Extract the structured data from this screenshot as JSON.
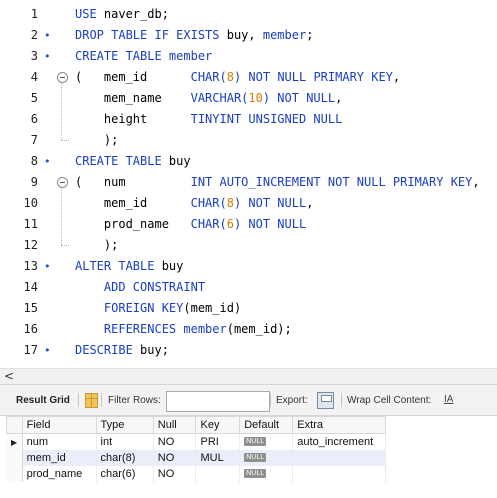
{
  "editor": {
    "lines": [
      {
        "n": "1",
        "marker": "",
        "fold": false,
        "tokens": [
          {
            "t": "USE ",
            "c": "kw"
          },
          {
            "t": "naver_db;",
            "c": "id"
          }
        ]
      },
      {
        "n": "2",
        "marker": "•",
        "fold": false,
        "tokens": [
          {
            "t": "DROP TABLE IF EXISTS ",
            "c": "kw"
          },
          {
            "t": "buy, ",
            "c": "id"
          },
          {
            "t": "member",
            "c": "kw"
          },
          {
            "t": ";",
            "c": "id"
          }
        ]
      },
      {
        "n": "3",
        "marker": "•",
        "fold": false,
        "tokens": [
          {
            "t": "CREATE TABLE ",
            "c": "kw"
          },
          {
            "t": "member",
            "c": "kw"
          }
        ]
      },
      {
        "n": "4",
        "marker": "",
        "fold": true,
        "tokens": [
          {
            "t": "(   ",
            "c": "id"
          },
          {
            "t": "mem_id      ",
            "c": "id"
          },
          {
            "t": "CHAR(",
            "c": "kw"
          },
          {
            "t": "8",
            "c": "num"
          },
          {
            "t": ") NOT NULL PRIMARY KEY",
            "c": "kw"
          },
          {
            "t": ",",
            "c": "id"
          }
        ]
      },
      {
        "n": "5",
        "marker": "",
        "fold": false,
        "tokens": [
          {
            "t": "    mem_name    ",
            "c": "id"
          },
          {
            "t": "VARCHAR(",
            "c": "kw"
          },
          {
            "t": "10",
            "c": "num"
          },
          {
            "t": ") NOT NULL",
            "c": "kw"
          },
          {
            "t": ",",
            "c": "id"
          }
        ]
      },
      {
        "n": "6",
        "marker": "",
        "fold": false,
        "tokens": [
          {
            "t": "    height      ",
            "c": "id"
          },
          {
            "t": "TINYINT UNSIGNED NULL",
            "c": "kw"
          }
        ]
      },
      {
        "n": "7",
        "marker": "",
        "fold": false,
        "tokens": [
          {
            "t": "    );",
            "c": "id"
          }
        ]
      },
      {
        "n": "8",
        "marker": "•",
        "fold": false,
        "tokens": [
          {
            "t": "CREATE TABLE ",
            "c": "kw"
          },
          {
            "t": "buy",
            "c": "id"
          }
        ]
      },
      {
        "n": "9",
        "marker": "",
        "fold": true,
        "tokens": [
          {
            "t": "(   ",
            "c": "id"
          },
          {
            "t": "num         ",
            "c": "id"
          },
          {
            "t": "INT AUTO_INCREMENT NOT NULL PRIMARY KEY",
            "c": "kw"
          },
          {
            "t": ",",
            "c": "id"
          }
        ]
      },
      {
        "n": "10",
        "marker": "",
        "fold": false,
        "tokens": [
          {
            "t": "    mem_id      ",
            "c": "id"
          },
          {
            "t": "CHAR(",
            "c": "kw"
          },
          {
            "t": "8",
            "c": "num"
          },
          {
            "t": ") NOT NULL",
            "c": "kw"
          },
          {
            "t": ",",
            "c": "id"
          }
        ]
      },
      {
        "n": "11",
        "marker": "",
        "fold": false,
        "tokens": [
          {
            "t": "    prod_name   ",
            "c": "id"
          },
          {
            "t": "CHAR(",
            "c": "kw"
          },
          {
            "t": "6",
            "c": "num"
          },
          {
            "t": ") NOT NULL",
            "c": "kw"
          }
        ]
      },
      {
        "n": "12",
        "marker": "",
        "fold": false,
        "tokens": [
          {
            "t": "    );",
            "c": "id"
          }
        ]
      },
      {
        "n": "13",
        "marker": "•",
        "fold": false,
        "tokens": [
          {
            "t": "ALTER TABLE ",
            "c": "kw"
          },
          {
            "t": "buy",
            "c": "id"
          }
        ]
      },
      {
        "n": "14",
        "marker": "",
        "fold": false,
        "tokens": [
          {
            "t": "    ADD CONSTRAINT",
            "c": "kw"
          }
        ]
      },
      {
        "n": "15",
        "marker": "",
        "fold": false,
        "tokens": [
          {
            "t": "    FOREIGN KEY",
            "c": "kw"
          },
          {
            "t": "(mem_id)",
            "c": "id"
          }
        ]
      },
      {
        "n": "16",
        "marker": "",
        "fold": false,
        "tokens": [
          {
            "t": "    REFERENCES ",
            "c": "kw"
          },
          {
            "t": "member",
            "c": "kw"
          },
          {
            "t": "(mem_id);",
            "c": "id"
          }
        ]
      },
      {
        "n": "17",
        "marker": "•",
        "fold": false,
        "tokens": [
          {
            "t": "DESCRIBE ",
            "c": "kw"
          },
          {
            "t": "buy;",
            "c": "id"
          }
        ]
      }
    ]
  },
  "scrollbar": {
    "left_arrow": "<"
  },
  "toolbar": {
    "result_grid_label": "Result Grid",
    "filter_rows_label": "Filter Rows:",
    "filter_value": "",
    "export_label": "Export:",
    "wrap_label": "Wrap Cell Content:",
    "wrap_icon": "IA"
  },
  "grid": {
    "columns": [
      "Field",
      "Type",
      "Null",
      "Key",
      "Default",
      "Extra"
    ],
    "rows": [
      {
        "current": true,
        "cells": [
          "num",
          "int",
          "NO",
          "PRI",
          "NULL",
          "auto_increment"
        ]
      },
      {
        "current": false,
        "cells": [
          "mem_id",
          "char(8)",
          "NO",
          "MUL",
          "NULL",
          ""
        ]
      },
      {
        "current": false,
        "cells": [
          "prod_name",
          "char(6)",
          "NO",
          "",
          "NULL",
          ""
        ]
      }
    ],
    "row_pointer": "▶"
  },
  "colors": {
    "keyword": "#1a3ec4",
    "number": "#d77d00",
    "selected_row": "#e9eef8"
  }
}
